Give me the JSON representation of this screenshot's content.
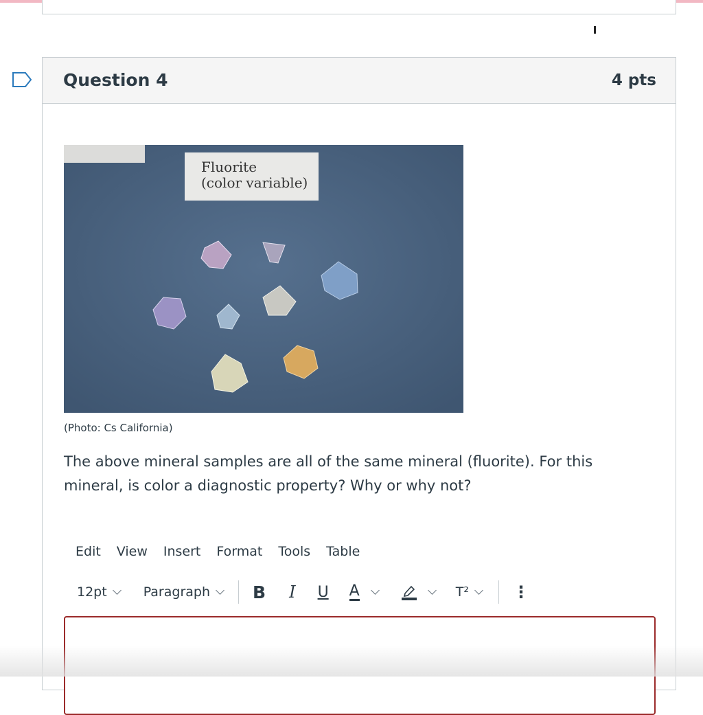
{
  "question": {
    "title": "Question 4",
    "points": "4 pts",
    "photo_label_line1": "Fluorite",
    "photo_label_line2": "(color variable)",
    "photo_credit": "(Photo: Cs California)",
    "text": "The above mineral samples are all of the same mineral (fluorite). For this mineral, is color a diagnostic property? Why or why not?"
  },
  "editor": {
    "menu": [
      "Edit",
      "View",
      "Insert",
      "Format",
      "Tools",
      "Table"
    ],
    "font_size": "12pt",
    "block_format": "Paragraph",
    "bold": "B",
    "italic": "I",
    "underline": "U",
    "text_color": "A",
    "superscript": "T²",
    "more": "⋮"
  },
  "colors": {
    "accent_top": "#f2b8c3",
    "editor_border": "#9b2a2a",
    "photo_background": "#4a6280"
  }
}
